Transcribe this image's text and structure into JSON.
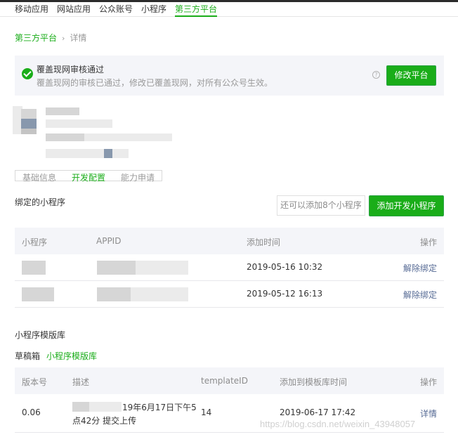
{
  "topnav": {
    "items": [
      {
        "label": "移动应用"
      },
      {
        "label": "网站应用"
      },
      {
        "label": "公众账号"
      },
      {
        "label": "小程序"
      },
      {
        "label": "第三方平台",
        "active": true
      }
    ]
  },
  "breadcrumb": {
    "parent": "第三方平台",
    "separator": "›",
    "current": "详情"
  },
  "notice": {
    "title": "覆盖现网审核通过",
    "description": "覆盖现网的审核已通过，修改已覆盖现网，对所有公众号生效。",
    "help_symbol": "?",
    "button_label": "修改平台"
  },
  "tabs": [
    {
      "label": "基础信息"
    },
    {
      "label": "开发配置",
      "active": true
    },
    {
      "label": "能力申请"
    }
  ],
  "bound": {
    "title": "绑定的小程序",
    "hint": "还可以添加8个小程序",
    "add_button": "添加开发小程序",
    "headers": [
      "小程序",
      "APPID",
      "添加时间",
      "操作"
    ],
    "rows": [
      {
        "time": "2019-05-16 10:32",
        "action": "解除绑定"
      },
      {
        "time": "2019-05-12 16:13",
        "action": "解除绑定"
      }
    ]
  },
  "template_lib": {
    "title": "小程序模版库",
    "subtabs": [
      {
        "label": "草稿箱"
      },
      {
        "label": "小程序模版库",
        "active": true
      }
    ],
    "headers": [
      "版本号",
      "描述",
      "templateID",
      "添加到模板库时间",
      "操作"
    ],
    "rows": [
      {
        "version": "0.06",
        "desc_line1": "19年6月17日下午5",
        "desc_line2": "点42分 提交上传",
        "template_id": "14",
        "added_time": "2019-06-17 17:42",
        "action": "详情"
      }
    ]
  },
  "watermark": "https://blog.csdn.net/weixin_43948057",
  "colors": {
    "accent": "#1aad19",
    "link": "#576b95",
    "panel": "#f4f5f9"
  }
}
